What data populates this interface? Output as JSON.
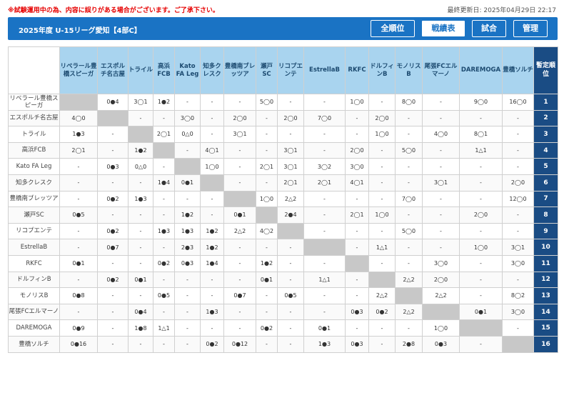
{
  "notice": "※試験運用中の為、内容に誤りがある場合がございます。ご了承下さい。",
  "last_updated": "最終更新日: 2025年04月29日 22:17",
  "league_title": "2025年度 U-15リーグ愛知【4部C】",
  "tabs": [
    {
      "label": "全順位",
      "active": false
    },
    {
      "label": "戦績表",
      "active": true
    },
    {
      "label": "試合",
      "active": false
    },
    {
      "label": "管理",
      "active": false
    }
  ],
  "rank_header": "暫定順位",
  "colors": {
    "brand": "#1a73c4",
    "header_bg": "#a9d4ef",
    "rank_bg": "#1a4c84",
    "self_cell": "#c8c8c8",
    "notice": "#e60000"
  },
  "teams": [
    {
      "row_name": "リベラール豊橋スピーガ",
      "col_name": "リベラール豊橋スピーガ",
      "rank": "1",
      "results": [
        "",
        "0●4",
        "3◯1",
        "1●2",
        "-",
        "-",
        "-",
        "5◯0",
        "-",
        "-",
        "1◯0",
        "-",
        "8◯0",
        "-",
        "9◯0",
        "16◯0"
      ]
    },
    {
      "row_name": "エスポルチ名古屋",
      "col_name": "エスポルチ名古屋",
      "rank": "2",
      "results": [
        "4◯0",
        "",
        "-",
        "-",
        "3◯0",
        "-",
        "2◯0",
        "-",
        "2◯0",
        "7◯0",
        "-",
        "2◯0",
        "-",
        "-",
        "-",
        "-"
      ]
    },
    {
      "row_name": "トライル",
      "col_name": "トライル",
      "rank": "3",
      "results": [
        "1●3",
        "-",
        "",
        "2◯1",
        "0△0",
        "-",
        "3◯1",
        "-",
        "-",
        "-",
        "-",
        "1◯0",
        "-",
        "4◯0",
        "8◯1",
        "-"
      ]
    },
    {
      "row_name": "高浜FCB",
      "col_name": "高浜FCB",
      "rank": "4",
      "results": [
        "2◯1",
        "-",
        "1●2",
        "",
        "-",
        "4◯1",
        "-",
        "-",
        "3◯1",
        "-",
        "2◯0",
        "-",
        "5◯0",
        "-",
        "1△1",
        "-"
      ]
    },
    {
      "row_name": "Kato FA Leg",
      "col_name": "Kato FA Leg",
      "rank": "5",
      "results": [
        "-",
        "0●3",
        "0△0",
        "-",
        "",
        "1◯0",
        "-",
        "2◯1",
        "3◯1",
        "3◯2",
        "3◯0",
        "-",
        "-",
        "-",
        "-",
        "-"
      ]
    },
    {
      "row_name": "知多クレスク",
      "col_name": "知多クレスク",
      "rank": "6",
      "results": [
        "-",
        "-",
        "-",
        "1●4",
        "0●1",
        "",
        "-",
        "-",
        "2◯1",
        "2◯1",
        "4◯1",
        "-",
        "-",
        "3◯1",
        "-",
        "2◯0"
      ]
    },
    {
      "row_name": "豊橋南ブレッツア",
      "col_name": "豊橋南ブレッツア",
      "rank": "7",
      "results": [
        "-",
        "0●2",
        "1●3",
        "-",
        "-",
        "-",
        "",
        "1◯0",
        "2△2",
        "-",
        "-",
        "-",
        "7◯0",
        "-",
        "-",
        "12◯0"
      ]
    },
    {
      "row_name": "瀬戸SC",
      "col_name": "瀬戸SC",
      "rank": "8",
      "results": [
        "0●5",
        "-",
        "-",
        "-",
        "1●2",
        "-",
        "0●1",
        "",
        "2●4",
        "-",
        "2◯1",
        "1◯0",
        "-",
        "-",
        "2◯0",
        "-"
      ]
    },
    {
      "row_name": "リコプエンテ",
      "col_name": "リコプエンテ",
      "rank": "9",
      "results": [
        "-",
        "0●2",
        "-",
        "1●3",
        "1●3",
        "1●2",
        "2△2",
        "4◯2",
        "",
        "-",
        "-",
        "-",
        "5◯0",
        "-",
        "-",
        "-"
      ]
    },
    {
      "row_name": "EstrellaB",
      "col_name": "EstrellaB",
      "rank": "10",
      "results": [
        "-",
        "0●7",
        "-",
        "-",
        "2●3",
        "1●2",
        "-",
        "-",
        "-",
        "",
        "-",
        "1△1",
        "-",
        "-",
        "1◯0",
        "3◯1"
      ]
    },
    {
      "row_name": "RKFC",
      "col_name": "RKFC",
      "rank": "11",
      "results": [
        "0●1",
        "-",
        "-",
        "0●2",
        "0●3",
        "1●4",
        "-",
        "1●2",
        "-",
        "-",
        "",
        "-",
        "-",
        "3◯0",
        "-",
        "3◯0"
      ]
    },
    {
      "row_name": "ドルフィンB",
      "col_name": "ドルフィンB",
      "rank": "12",
      "results": [
        "-",
        "0●2",
        "0●1",
        "-",
        "-",
        "-",
        "-",
        "0●1",
        "-",
        "1△1",
        "-",
        "",
        "2△2",
        "2◯0",
        "-",
        "-"
      ]
    },
    {
      "row_name": "モノリスB",
      "col_name": "モノリスB",
      "rank": "13",
      "results": [
        "0●8",
        "-",
        "-",
        "0●5",
        "-",
        "-",
        "0●7",
        "-",
        "0●5",
        "-",
        "-",
        "2△2",
        "",
        "2△2",
        "-",
        "8◯2"
      ]
    },
    {
      "row_name": "尾張FCエルマーノ",
      "col_name": "尾張FCエルマーノ",
      "rank": "14",
      "results": [
        "-",
        "-",
        "0●4",
        "-",
        "-",
        "1●3",
        "-",
        "-",
        "-",
        "-",
        "0●3",
        "0●2",
        "2△2",
        "",
        "0●1",
        "3◯0"
      ]
    },
    {
      "row_name": "DAREMOGA",
      "col_name": "DAREMOGA",
      "rank": "15",
      "results": [
        "0●9",
        "-",
        "1●8",
        "1△1",
        "-",
        "-",
        "-",
        "0●2",
        "-",
        "0●1",
        "-",
        "-",
        "-",
        "1◯0",
        "",
        "-"
      ]
    },
    {
      "row_name": "豊橋ソルチ",
      "col_name": "豊橋ソルチ",
      "rank": "16",
      "results": [
        "0●16",
        "-",
        "-",
        "-",
        "-",
        "0●2",
        "0●12",
        "-",
        "-",
        "1●3",
        "0●3",
        "-",
        "2●8",
        "0●3",
        "-",
        ""
      ]
    }
  ]
}
